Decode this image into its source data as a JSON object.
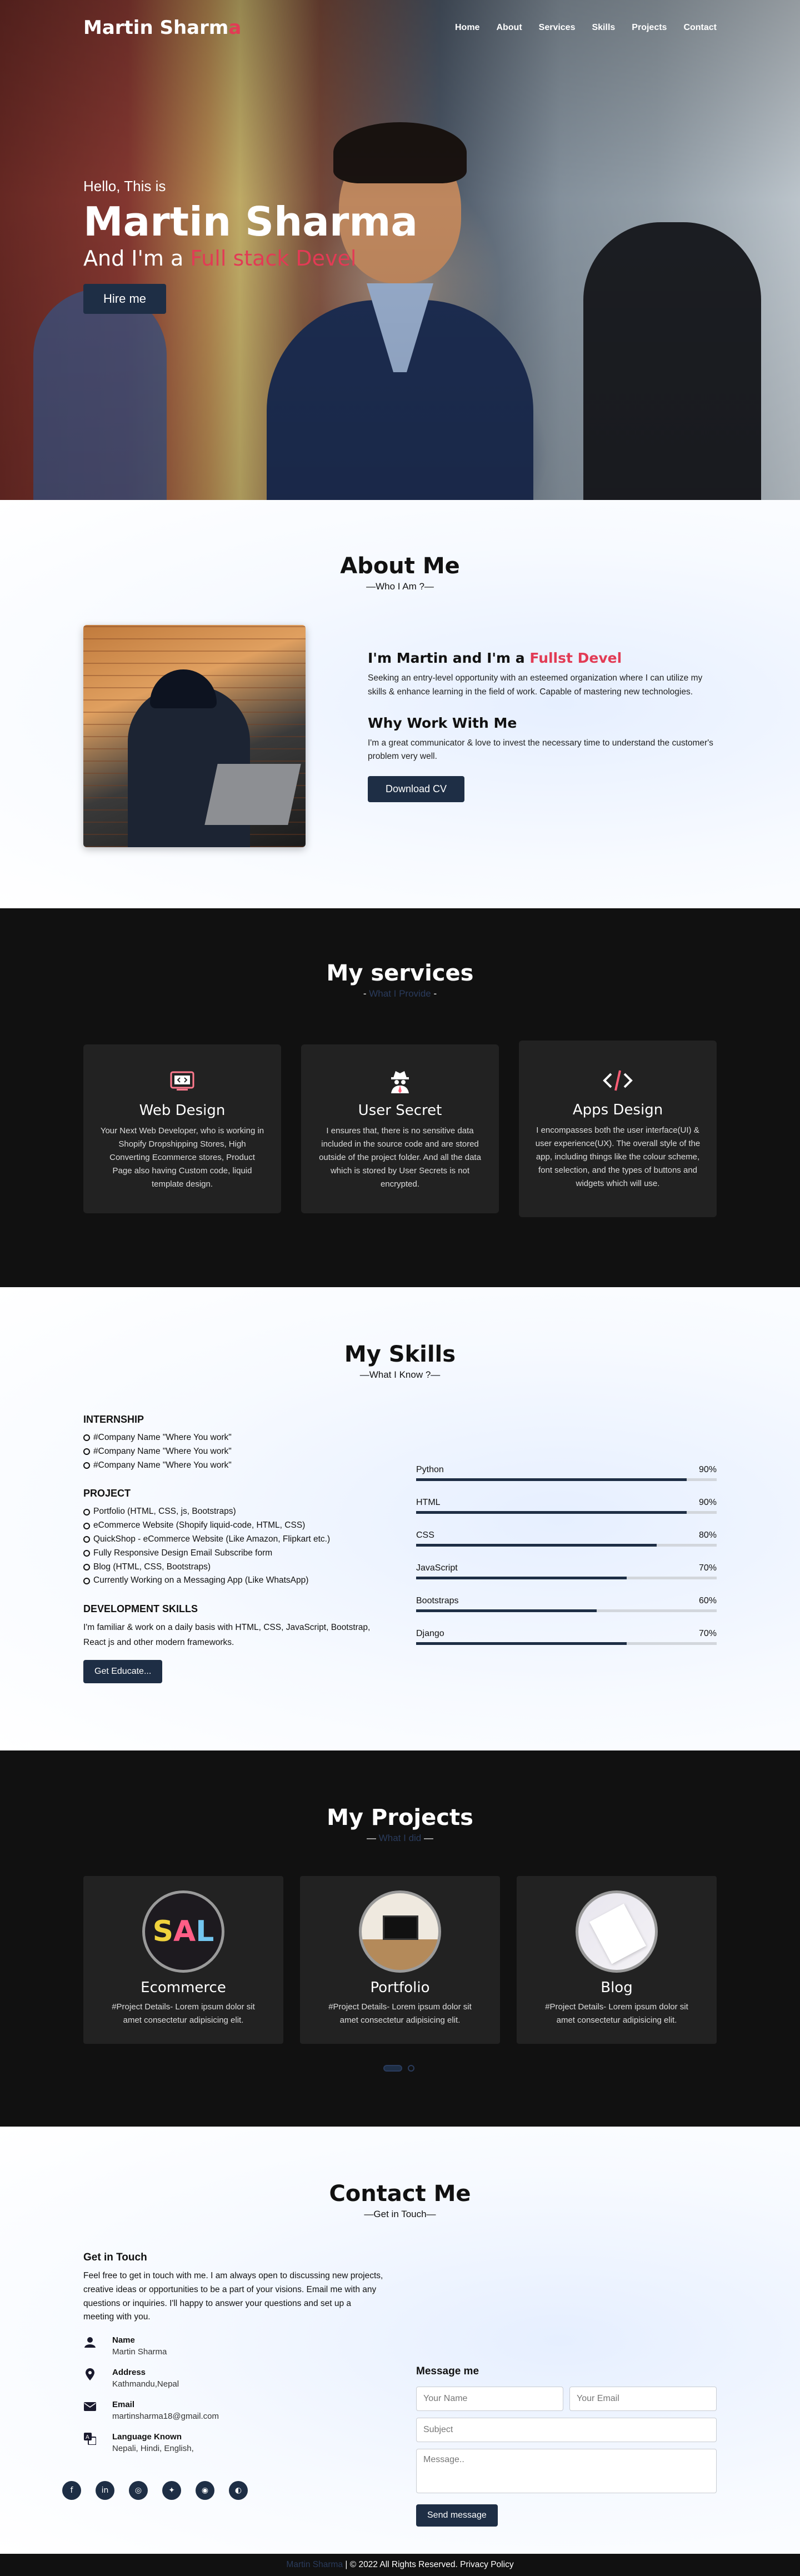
{
  "nav": {
    "logo_main": "Martin Sharm",
    "logo_accent": "a",
    "items": [
      "Home",
      "About",
      "Services",
      "Skills",
      "Projects",
      "Contact"
    ]
  },
  "hero": {
    "hello": "Hello, This is",
    "name": "Martin Sharma",
    "role_prefix": "And I'm a ",
    "role_typed": "Full stack Devel",
    "hire_button": "Hire me"
  },
  "about": {
    "title": "About Me",
    "subtitle": "—Who I Am ?—",
    "heading_prefix": "I'm Martin and I'm a ",
    "heading_typed": "Fullst Devel",
    "paragraph1": "Seeking an entry-level opportunity with an esteemed organization where I can utilize my skills & enhance learning in the field of work. Capable of mastering new technologies.",
    "why_title": "Why Work With Me",
    "paragraph2": "I'm a great communicator & love to invest the necessary time to understand the customer's problem very well.",
    "cv_button": "Download CV"
  },
  "services": {
    "title": "My services",
    "subtitle_text": "What I Provide",
    "cards": [
      {
        "icon": "▣",
        "title": "Web Design",
        "text": "Your Next Web Developer, who is working in Shopify Dropshipping Stores, High Converting Ecommerce stores, Product Page also having Custom code, liquid template design."
      },
      {
        "icon": "☠",
        "title": "User Secret",
        "text": "I ensures that, there is no sensitive data included in the source code and are stored outside of the project folder. And all the data which is stored by User Secrets is not encrypted."
      },
      {
        "icon": "</>",
        "title": "Apps Design",
        "text": "I encompasses both the user interface(UI) & user experience(UX). The overall style of the app, including things like the colour scheme, font selection, and the types of buttons and widgets which will use."
      }
    ]
  },
  "skills": {
    "title": "My Skills",
    "subtitle": "—What I Know ?—",
    "internship_title": "INTERNSHIP",
    "internships": [
      "#Company Name \"Where You work\"",
      "#Company Name \"Where You work\"",
      "#Company Name \"Where You work\""
    ],
    "project_title": "PROJECT",
    "projects": [
      "Portfolio (HTML, CSS, js, Bootstraps)",
      "eCommerce Website (Shopify liquid-code, HTML, CSS)",
      "QuickShop - eCommerce Website (Like Amazon, Flipkart etc.)",
      "Fully Responsive Design Email Subscribe form",
      "Blog (HTML, CSS, Bootstraps)",
      "Currently Working on a Messaging App (Like WhatsApp)"
    ],
    "dev_title": "DEVELOPMENT SKILLS",
    "dev_text": "I'm familiar & work on a daily basis with HTML, CSS, JavaScript, Bootstrap, React js and other modern frameworks.",
    "edu_button": "Get Educate...",
    "bars": [
      {
        "name": "Python",
        "percent": "90%",
        "value": 0.9
      },
      {
        "name": "HTML",
        "percent": "90%",
        "value": 0.9
      },
      {
        "name": "CSS",
        "percent": "80%",
        "value": 0.8
      },
      {
        "name": "JavaScript",
        "percent": "70%",
        "value": 0.7
      },
      {
        "name": "Bootstraps",
        "percent": "60%",
        "value": 0.6
      },
      {
        "name": "Django",
        "percent": "70%",
        "value": 0.7
      }
    ]
  },
  "projects": {
    "title": "My Projects",
    "subtitle_text": "What I did",
    "cards": [
      {
        "title": "Ecommerce",
        "text": "#Project Details- Lorem ipsum dolor sit amet consectetur adipisicing elit."
      },
      {
        "title": "Portfolio",
        "text": "#Project Details- Lorem ipsum dolor sit amet consectetur adipisicing elit."
      },
      {
        "title": "Blog",
        "text": "#Project Details- Lorem ipsum dolor sit amet consectetur adipisicing elit."
      }
    ],
    "ecommerce_logo": {
      "s": "S",
      "a": "A",
      "l": "L"
    }
  },
  "contact": {
    "title": "Contact Me",
    "subtitle": "—Get in Touch—",
    "get_in_touch": "Get in Touch",
    "intro": "Feel free to get in touch with me. I am always open to discussing new projects, creative ideas or opportunities to be a part of your visions. Email me with any questions or inquiries. I'll happy to answer your questions and set up a meeting with you.",
    "info": [
      {
        "label": "Name",
        "value": "Martin Sharma"
      },
      {
        "label": "Address",
        "value": "Kathmandu,Nepal"
      },
      {
        "label": "Email",
        "value": "martinsharma18@gmail.com"
      },
      {
        "label": "Language Known",
        "value": "Nepali, Hindi, English,"
      }
    ],
    "message_title": "Message me",
    "name_placeholder": "Your Name",
    "email_placeholder": "Your Email",
    "subject_placeholder": "Subject",
    "message_placeholder": "Message..",
    "send_button": "Send message",
    "socials": [
      "f",
      "in",
      "◎",
      "✦",
      "◉",
      "◐"
    ]
  },
  "footer": {
    "brand": "Martin Sharma",
    "rest": " | © 2022 All Rights Reserved. Privacy Policy"
  }
}
